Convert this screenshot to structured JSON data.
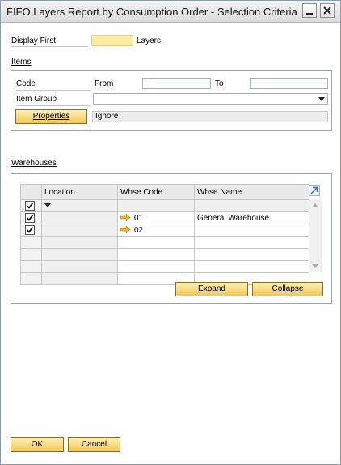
{
  "window": {
    "title": "FIFO Layers Report by Consumption Order - Selection Criteria",
    "minimize_icon": "minimize-icon",
    "close_icon": "close-icon"
  },
  "display_first": {
    "label": "Display First",
    "value": "",
    "suffix": "Layers"
  },
  "items": {
    "section_label": "Items",
    "code_label": "Code",
    "from_label": "From",
    "from_value": "",
    "to_label": "To",
    "to_value": "",
    "item_group_label": "Item Group",
    "item_group_value": "",
    "properties_button": "Properties",
    "properties_value": "Ignore"
  },
  "warehouses": {
    "section_label": "Warehouses",
    "columns": [
      "",
      "Location",
      "Whse Code",
      "Whse Name"
    ],
    "rows": [
      {
        "checked": true,
        "location": "",
        "code": "",
        "name": "",
        "filter_row": true
      },
      {
        "checked": true,
        "location": "",
        "code": "01",
        "name": "General Warehouse",
        "filter_row": false
      },
      {
        "checked": true,
        "location": "",
        "code": "02",
        "name": "",
        "filter_row": false
      }
    ],
    "expand_button": "Expand",
    "collapse_button": "Collapse"
  },
  "footer": {
    "ok_button": "OK",
    "cancel_button": "Cancel"
  },
  "colors": {
    "accent_button": "#f2c756",
    "highlight_field": "#fbeba3",
    "link_arrow": "#f2b21c"
  }
}
